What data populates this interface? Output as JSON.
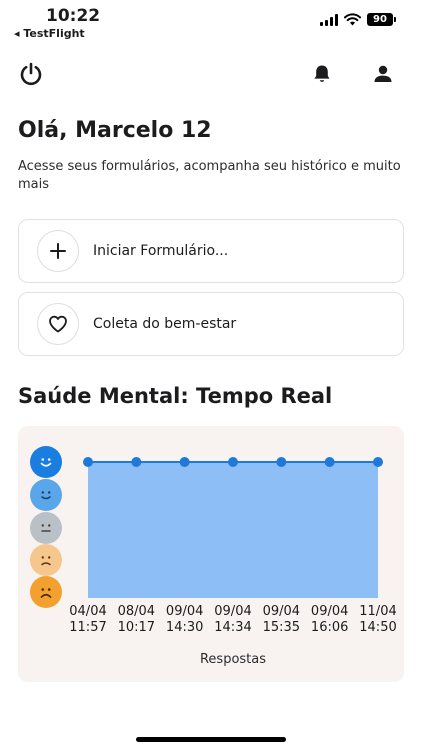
{
  "status_bar": {
    "time": "10:22",
    "back_app": "◂ TestFlight",
    "battery": "90"
  },
  "header": {
    "power_icon": "power-icon",
    "bell_icon": "bell-icon",
    "profile_icon": "person-icon"
  },
  "greeting": "Olá, Marcelo 12",
  "subtitle": "Acesse seus formulários, acompanha seu histórico e muito mais",
  "actions": [
    {
      "label": "Iniciar Formulário...",
      "icon": "plus-icon"
    },
    {
      "label": "Coleta do bem-estar",
      "icon": "heart-icon"
    }
  ],
  "section_title": "Saúde Mental: Tempo Real",
  "colors": {
    "face_very_happy": "#1a7de0",
    "face_happy": "#5aa6ea",
    "face_neutral": "#b9c1c7",
    "face_sad": "#f6c78d",
    "face_very_sad": "#f2a12e",
    "area_fill": "#8dbff6",
    "line": "#1f79d8"
  },
  "chart_data": {
    "type": "area",
    "x": [
      "04/04 11:57",
      "08/04 10:17",
      "09/04 14:30",
      "09/04 14:34",
      "09/04 15:35",
      "09/04 16:06",
      "11/04 14:50"
    ],
    "x_labels": [
      [
        "04/04",
        "11:57"
      ],
      [
        "08/04",
        "10:17"
      ],
      [
        "09/04",
        "14:30"
      ],
      [
        "09/04",
        "14:34"
      ],
      [
        "09/04",
        "15:35"
      ],
      [
        "09/04",
        "16:06"
      ],
      [
        "11/04",
        "14:50"
      ]
    ],
    "series": [
      {
        "values": [
          5,
          5,
          5,
          5,
          5,
          5,
          5
        ]
      }
    ],
    "y_levels": [
      "very-happy",
      "happy",
      "neutral",
      "sad",
      "very-sad"
    ],
    "ylim": [
      1,
      5
    ],
    "xlabel": "Respostas",
    "ylabel": "",
    "grid": false
  }
}
